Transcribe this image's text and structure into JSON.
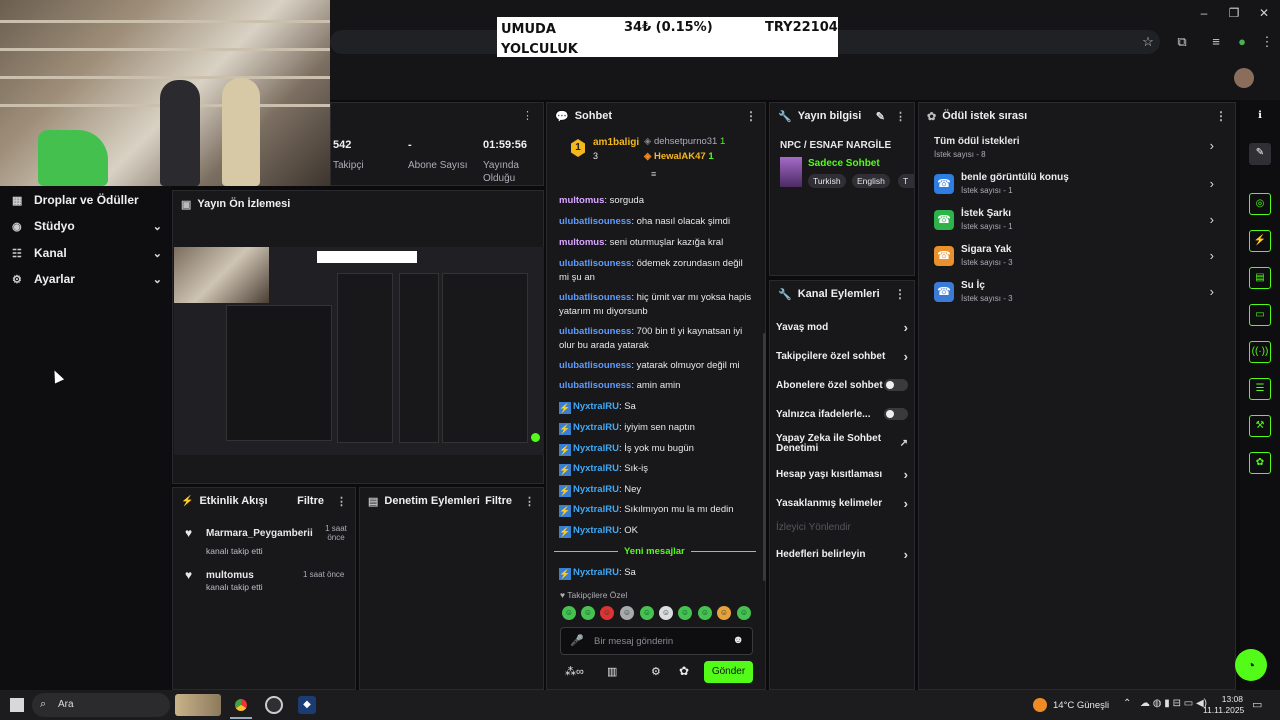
{
  "ticker": {
    "name": "UMUDA YOLCULUK",
    "change": "34₺ (0.15%)",
    "goal": "TRY22104"
  },
  "stats": [
    {
      "value": "542",
      "label": "Takipçi"
    },
    {
      "value": "-",
      "label": "Abone Sayısı"
    },
    {
      "value": "01:59:56",
      "label": "Yayında Olduğu"
    }
  ],
  "leftnav": {
    "items": [
      {
        "label": "Droplar ve Ödüller",
        "icon": "gift-icon"
      },
      {
        "label": "Stüdyo",
        "icon": "studio-icon"
      },
      {
        "label": "Kanal",
        "icon": "channel-icon"
      },
      {
        "label": "Ayarlar",
        "icon": "gear-icon"
      }
    ]
  },
  "preview": {
    "title": "Yayın Ön İzlemesi"
  },
  "activity": {
    "title": "Etkinlik Akışı",
    "filter": "Filtre",
    "events": [
      {
        "user": "Marmara_Peygamberii",
        "action": "kanalı takip etti",
        "time": "1 saat önce"
      },
      {
        "user": "multomus",
        "action": "kanalı takip etti",
        "time": "1 saat önce"
      }
    ]
  },
  "moderation": {
    "title": "Denetim Eylemleri",
    "filter": "Filtre"
  },
  "chat": {
    "title": "Sohbet",
    "leaders": [
      {
        "name": "am1baligi",
        "count": "3",
        "rank": "1"
      },
      {
        "name": "dehsetpurno31",
        "count": "1"
      },
      {
        "name": "HewalAK47",
        "count": "1"
      }
    ],
    "messages": [
      {
        "user": "multomus",
        "text": ": sorguda"
      },
      {
        "user": "ulubatlisouness",
        "text": ": oha nasıl olacak şimdi"
      },
      {
        "user": "multomus",
        "text": ": seni oturmuşlar kazığa kral"
      },
      {
        "user": "ulubatlisouness",
        "text": ": ödemek zorundasın değil mi şu an"
      },
      {
        "user": "ulubatlisouness",
        "text": ": hiç ümit var mı yoksa hapis yatarım mı diyorsunb"
      },
      {
        "user": "ulubatlisouness",
        "text": ": 700 bin tl yi kaynatsan iyi olur bu arada yatarak"
      },
      {
        "user": "ulubatlisouness",
        "text": ": yatarak olmuyor değil mi"
      },
      {
        "user": "ulubatlisouness",
        "text": ": amin amin"
      },
      {
        "user": "NyxtralRU",
        "text": ": Sa"
      },
      {
        "user": "NyxtralRU",
        "text": ": iyiyim sen naptın"
      },
      {
        "user": "NyxtralRU",
        "text": ": İş yok mu bugün"
      },
      {
        "user": "NyxtralRU",
        "text": ": Sık-iş"
      },
      {
        "user": "NyxtralRU",
        "text": ": Ney"
      },
      {
        "user": "NyxtralRU",
        "text": ": Sıkılmıyon mu la mı dedin"
      },
      {
        "user": "NyxtralRU",
        "text": ": OK"
      }
    ],
    "new_messages": "Yeni mesajlar",
    "after": {
      "user": "NyxtralRU",
      "text": ": Sa"
    },
    "followers_only": "Takipçilere Özel",
    "placeholder": "Bir mesaj gönderin",
    "send": "Gönder"
  },
  "streaminfo": {
    "title": "Yayın bilgisi",
    "stream_title": "NPC / ESNAF NARGİLE",
    "category": "Sadece Sohbet",
    "tags": [
      "Turkish",
      "English",
      "T"
    ]
  },
  "channel_actions": {
    "title": "Kanal Eylemleri",
    "items": [
      {
        "label": "Yavaş mod",
        "kind": "chevron"
      },
      {
        "label": "Takipçilere özel sohbet",
        "kind": "chevron"
      },
      {
        "label": "Abonelere özel sohbet",
        "kind": "toggle"
      },
      {
        "label": "Yalnızca ifadelerle...",
        "kind": "toggle"
      },
      {
        "label": "Yapay Zeka ile Sohbet Denetimi",
        "kind": "external"
      },
      {
        "label": "Hesap yaşı kısıtlaması",
        "kind": "chevron"
      },
      {
        "label": "Yasaklanmış kelimeler",
        "kind": "chevron"
      },
      {
        "label": "İzleyici Yönlendir",
        "kind": "disabled"
      },
      {
        "label": "Hedefleri belirleyin",
        "kind": "chevron"
      }
    ]
  },
  "rewards": {
    "title": "Ödül istek sırası",
    "all": {
      "label": "Tüm ödül istekleri",
      "sub": "İstek sayısı - 8"
    },
    "items": [
      {
        "label": "benle görüntülü konuş",
        "sub": "İstek sayısı - 1",
        "color": "#2f7de1"
      },
      {
        "label": "İstek Şarkı",
        "sub": "İstek sayısı - 1",
        "color": "#2db34a"
      },
      {
        "label": "Sigara Yak",
        "sub": "İstek sayısı - 3",
        "color": "#e8912d"
      },
      {
        "label": "Su İç",
        "sub": "İstek sayısı - 3",
        "color": "#3a7bd5"
      }
    ]
  },
  "taskbar": {
    "search": "Ara",
    "weather": "14°C",
    "weather_desc": "Güneşli",
    "time": "13:08",
    "date": "11.11.2025"
  },
  "colors": {
    "accent_green": "#53fc18",
    "panel": "#18181b",
    "background": "#0b0b0c"
  }
}
